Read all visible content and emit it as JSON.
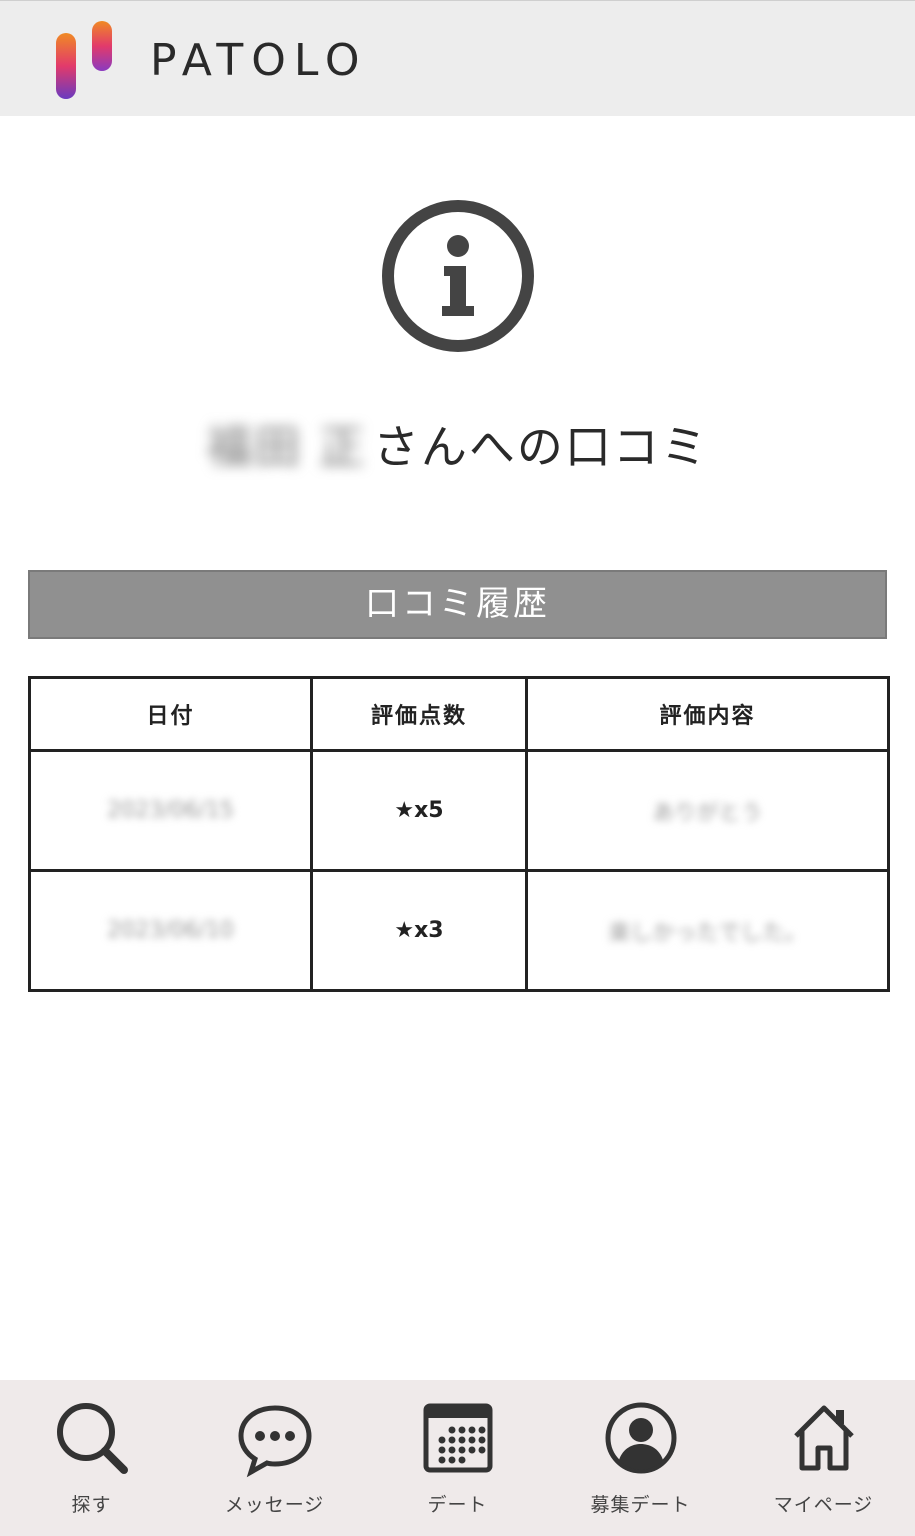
{
  "header": {
    "logo_text": "PATOLO"
  },
  "page": {
    "title_name": "福田 正",
    "title_suffix": "さんへの口コミ"
  },
  "section": {
    "label": "口コミ履歴"
  },
  "table": {
    "headers": [
      "日付",
      "評価点数",
      "評価内容"
    ],
    "rows": [
      {
        "date": "2023/06/15",
        "rating": "★x5",
        "content": "ありがとう"
      },
      {
        "date": "2023/06/10",
        "rating": "★x3",
        "content": "楽しかったでした。"
      }
    ]
  },
  "nav": {
    "items": [
      {
        "label": "探す",
        "icon": "search-icon"
      },
      {
        "label": "メッセージ",
        "icon": "chat-bubble-icon"
      },
      {
        "label": "デート",
        "icon": "calendar-icon"
      },
      {
        "label": "募集デート",
        "icon": "user-circle-icon"
      },
      {
        "label": "マイページ",
        "icon": "home-icon"
      }
    ]
  },
  "colors": {
    "header_bg": "#ededed",
    "section_bar": "#909090",
    "nav_bg": "#efeaea",
    "logo_gradient": [
      "#f08a24",
      "#e23a6b",
      "#6a3ac0"
    ]
  }
}
